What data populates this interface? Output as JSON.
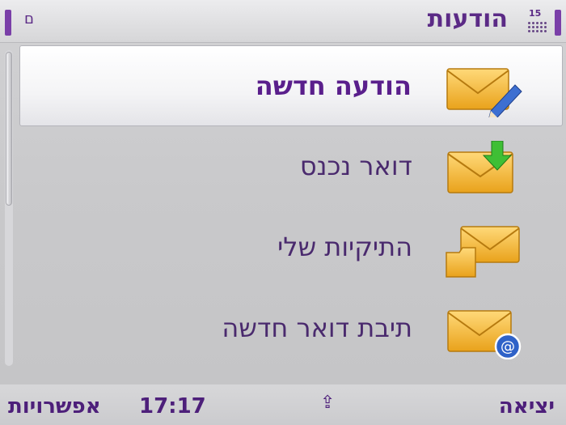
{
  "status": {
    "title": "הודעות",
    "signal_icon_number": "15",
    "left_indicator": "ם"
  },
  "menu": {
    "items": [
      {
        "label": "הודעה חדשה",
        "icon": "envelope-pencil-icon",
        "selected": true
      },
      {
        "label": "דואר נכנס",
        "icon": "envelope-inbox-arrow-icon",
        "selected": false
      },
      {
        "label": "התיקיות שלי",
        "icon": "envelope-folders-icon",
        "selected": false
      },
      {
        "label": "תיבת דואר חדשה",
        "icon": "envelope-at-icon",
        "selected": false
      }
    ]
  },
  "softkeys": {
    "left": "אפשרויות",
    "time": "17:17",
    "middle": "⇪",
    "right": "יציאה"
  },
  "colors": {
    "accent": "#5b2a86",
    "envelope": "#f2b632",
    "highlight": "#ffffff"
  }
}
